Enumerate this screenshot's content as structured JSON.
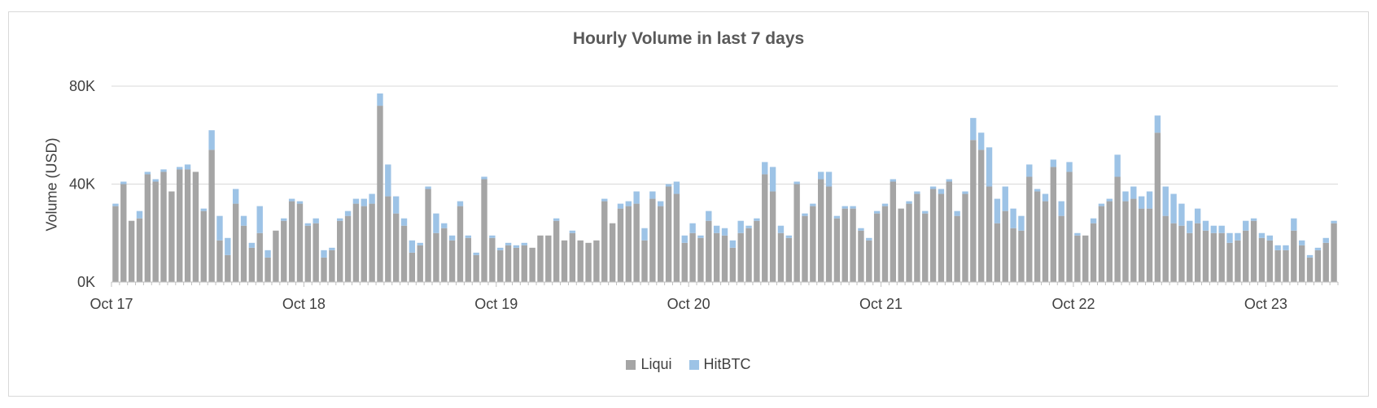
{
  "chart_data": {
    "type": "bar",
    "stacked": true,
    "title": "Hourly Volume in last 7 days",
    "ylabel": "Volume (USD)",
    "xlabel": "",
    "ylim": [
      0,
      80000
    ],
    "yticks": [
      0,
      40000,
      80000
    ],
    "ytick_labels": [
      "0K",
      "40K",
      "80K"
    ],
    "xtick_labels": [
      "Oct 17",
      "Oct 18",
      "Oct 19",
      "Oct 20",
      "Oct 21",
      "Oct 22",
      "Oct 23"
    ],
    "grid": true,
    "legend_position": "bottom",
    "colors": {
      "Liqui": "#a5a5a5",
      "HitBTC": "#9dc3e6"
    },
    "series": [
      {
        "name": "Liqui",
        "values": [
          31000,
          40000,
          25000,
          26000,
          44000,
          41000,
          45000,
          37000,
          46000,
          46000,
          45000,
          29000,
          54000,
          17000,
          11000,
          32000,
          23000,
          14000,
          20000,
          10000,
          21000,
          25000,
          33000,
          32000,
          23000,
          24000,
          10000,
          13000,
          25000,
          27000,
          32000,
          31000,
          32000,
          72000,
          35000,
          28000,
          23000,
          12000,
          15000,
          38000,
          20000,
          22000,
          17000,
          31000,
          18000,
          11000,
          42000,
          18000,
          13000,
          15000,
          14000,
          15000,
          14000,
          19000,
          19000,
          25000,
          17000,
          20000,
          17000,
          16000,
          17000,
          33000,
          24000,
          30000,
          31000,
          32000,
          17000,
          34000,
          31000,
          39000,
          36000,
          16000,
          20000,
          18000,
          25000,
          20000,
          19000,
          14000,
          20000,
          22000,
          25000,
          44000,
          37000,
          20000,
          18000,
          40000,
          27000,
          31000,
          42000,
          39000,
          26000,
          30000,
          30000,
          21000,
          17000,
          28000,
          31000,
          41000,
          30000,
          32000,
          36000,
          28000,
          38000,
          36000,
          41000,
          27000,
          36000,
          58000,
          54000,
          39000,
          24000,
          29000,
          22000,
          21000,
          43000,
          37000,
          33000,
          47000,
          27000,
          45000,
          19000,
          19000,
          24000,
          31000,
          33000,
          43000,
          33000,
          34000,
          30000,
          30000,
          61000,
          27000,
          24000,
          23000,
          20000,
          24000,
          21000,
          20000,
          20000,
          16000,
          17000,
          21000,
          25000,
          18000,
          17000,
          13000,
          13000,
          21000,
          15000,
          10000,
          13000,
          16000,
          24000
        ]
      },
      {
        "name": "HitBTC",
        "values": [
          1000,
          1000,
          0,
          3000,
          1000,
          1000,
          1000,
          0,
          1000,
          2000,
          0,
          1000,
          8000,
          10000,
          7000,
          6000,
          4000,
          2000,
          11000,
          3000,
          0,
          1000,
          1000,
          1000,
          1000,
          2000,
          3000,
          1000,
          1000,
          2000,
          2000,
          3000,
          4000,
          5000,
          13000,
          7000,
          3000,
          5000,
          1000,
          1000,
          8000,
          2000,
          2000,
          2000,
          1000,
          1000,
          1000,
          1000,
          1000,
          1000,
          1000,
          1000,
          0,
          0,
          0,
          1000,
          0,
          1000,
          0,
          0,
          0,
          1000,
          0,
          2000,
          2000,
          5000,
          5000,
          3000,
          2000,
          1000,
          5000,
          3000,
          4000,
          1000,
          4000,
          3000,
          3000,
          3000,
          5000,
          1000,
          1000,
          5000,
          10000,
          3000,
          1000,
          1000,
          1000,
          1000,
          3000,
          6000,
          1000,
          1000,
          1000,
          1000,
          1000,
          1000,
          1000,
          1000,
          0,
          1000,
          1000,
          1000,
          1000,
          2000,
          1000,
          2000,
          1000,
          9000,
          7000,
          16000,
          10000,
          10000,
          8000,
          6000,
          5000,
          1000,
          3000,
          3000,
          6000,
          4000,
          1000,
          0,
          2000,
          1000,
          1000,
          9000,
          4000,
          5000,
          5000,
          7000,
          7000,
          12000,
          12000,
          9000,
          5000,
          6000,
          4000,
          3000,
          3000,
          4000,
          3000,
          4000,
          1000,
          2000,
          2000,
          2000,
          2000,
          5000,
          2000,
          1000,
          1000,
          2000,
          1000
        ]
      }
    ]
  }
}
